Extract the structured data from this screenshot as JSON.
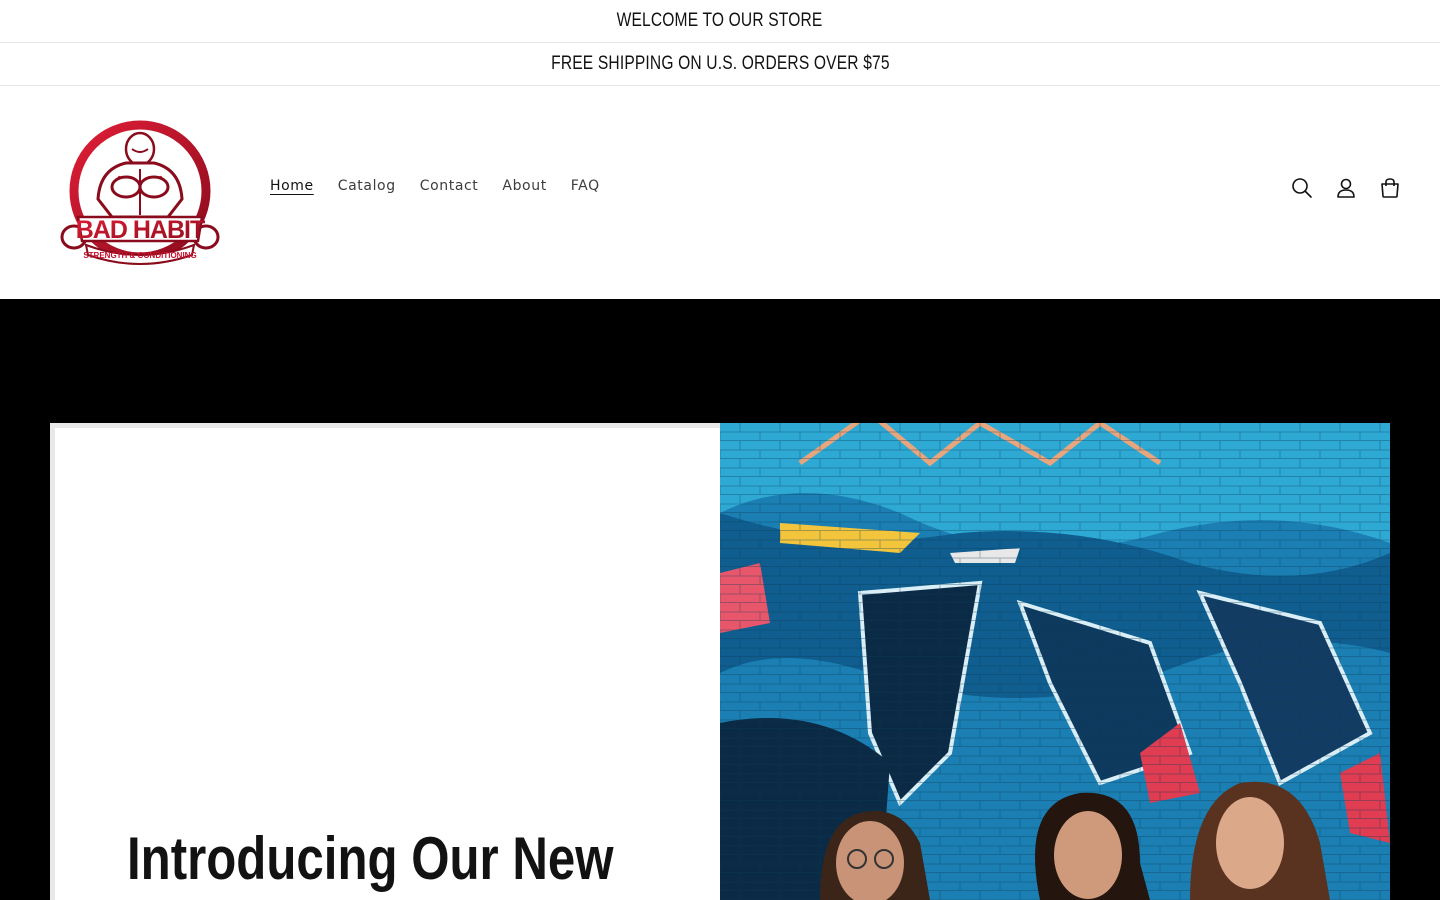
{
  "announcements": [
    "WELCOME TO OUR STORE",
    "FREE SHIPPING ON U.S. ORDERS OVER $75"
  ],
  "logo": {
    "alt": "Bad Habit Strength & Conditioning",
    "wordmark": "BAD HABIT",
    "tagline": "STRENGTH & CONDITIONING",
    "color": "#c8102e"
  },
  "nav": {
    "items": [
      {
        "label": "Home",
        "active": true
      },
      {
        "label": "Catalog"
      },
      {
        "label": "Contact"
      },
      {
        "label": "About"
      },
      {
        "label": "FAQ"
      }
    ]
  },
  "header_icons": [
    "search-icon",
    "account-icon",
    "cart-icon"
  ],
  "hero": {
    "title": "Introducing Our New",
    "image_alt": "Three women in front of a graffiti brick wall"
  },
  "colors": {
    "accent": "#c8102e",
    "hero_bg": "#000000",
    "graffiti_blue": "#1f8fc4"
  }
}
